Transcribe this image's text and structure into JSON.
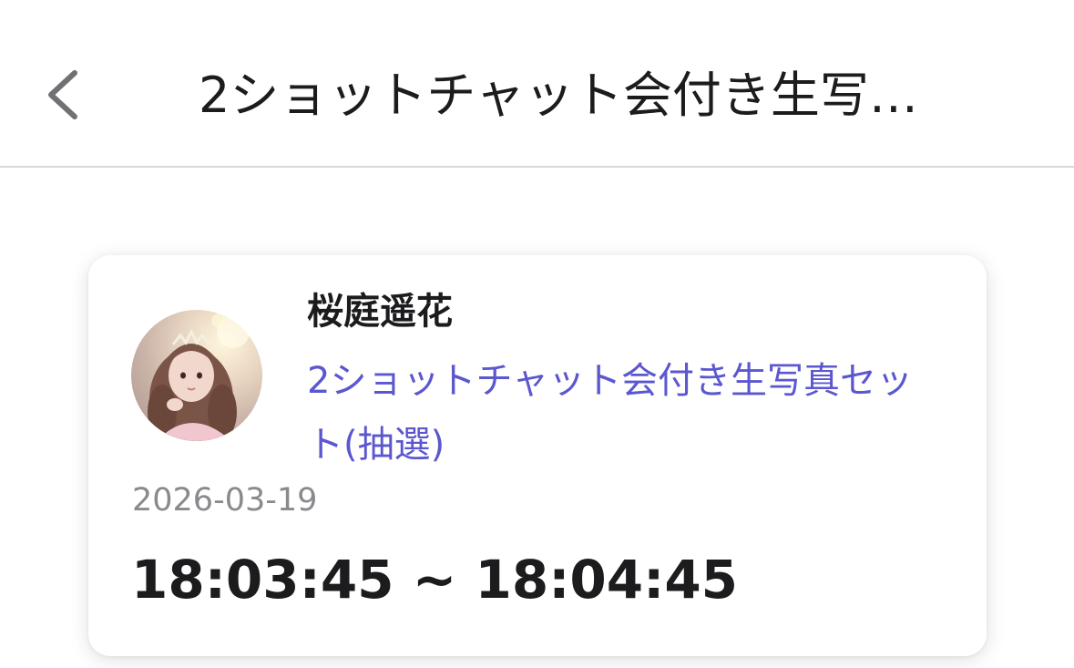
{
  "header": {
    "back_icon": "chevron-left-icon",
    "title": "2ショットチャット会付き生写…"
  },
  "card": {
    "creator_name": "桜庭遥花",
    "product_title": "2ショットチャット会付き生写真セット(抽選)",
    "date": "2026-03-19",
    "time_range": "18:03:45 ~ 18:04:45"
  },
  "colors": {
    "link": "#5b57cf",
    "text_primary": "#1c1c1e",
    "text_secondary": "#8a8a8e",
    "divider": "#d9d9d9"
  }
}
